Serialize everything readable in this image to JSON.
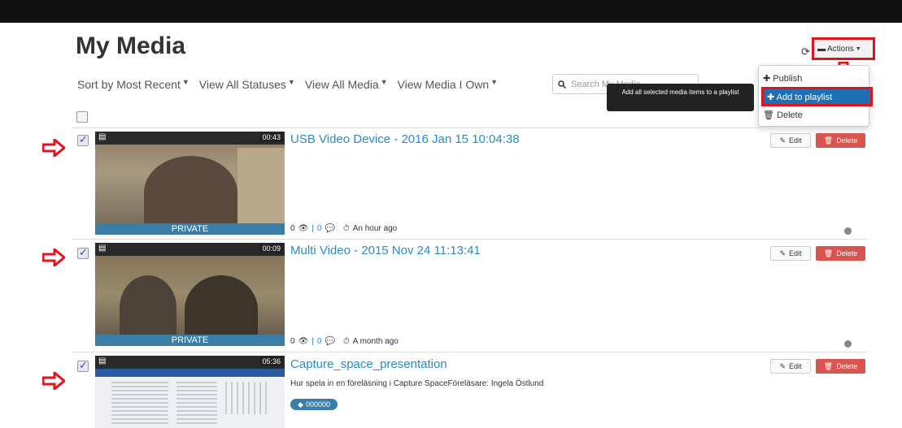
{
  "page": {
    "title": "My Media"
  },
  "filters": [
    {
      "label": "Sort by Most Recent"
    },
    {
      "label": "View All Statuses"
    },
    {
      "label": "View All Media"
    },
    {
      "label": "View Media I Own"
    }
  ],
  "search": {
    "placeholder": "Search My Media"
  },
  "actions": {
    "button_label": "Actions",
    "menu": [
      {
        "label": "Publish",
        "icon": "plus-icon"
      },
      {
        "label": "Add to playlist",
        "icon": "plus-icon",
        "highlighted": true
      },
      {
        "label": "Delete",
        "icon": "trash-icon"
      }
    ],
    "tooltip": "Add all selected media items to a playlist"
  },
  "entries": [
    {
      "title": "USB Video Device - 2016 Jan 15 10:04:38",
      "duration": "00:43",
      "badge": "PRIVATE",
      "views": "0",
      "comments": "0",
      "time": "An hour ago",
      "checked": true
    },
    {
      "title": "Multi Video - 2015 Nov 24 11:13:41",
      "duration": "00:09",
      "badge": "PRIVATE",
      "views": "0",
      "comments": "0",
      "time": "A month ago",
      "checked": true
    },
    {
      "title": "Capture_space_presentation",
      "duration": "05:36",
      "description": "Hur spela in en föreläsning i Capture SpaceFöreläsare: Ingela Östlund",
      "tag": "000000",
      "checked": true
    }
  ],
  "buttons": {
    "edit": "Edit",
    "delete": "Delete"
  },
  "colors": {
    "accent": "#2a8ac7",
    "danger": "#d9534f",
    "highlight": "#e0141e",
    "menu_active": "#1f6fb4"
  }
}
